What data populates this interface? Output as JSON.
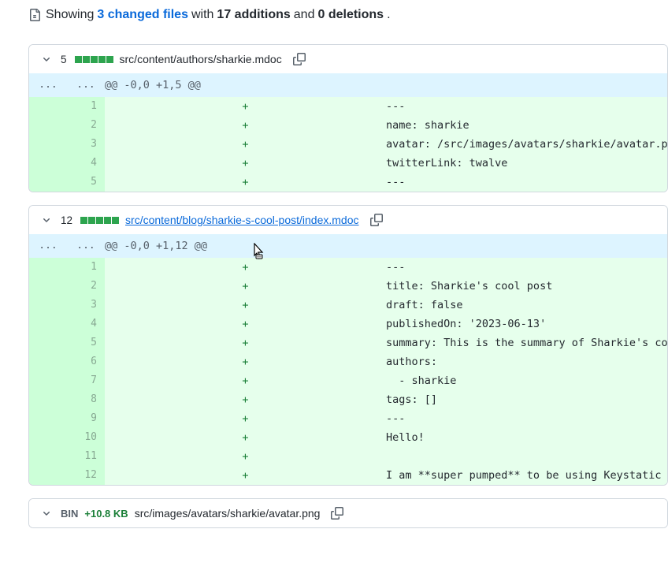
{
  "summary": {
    "prefix": "Showing",
    "files_count": "3 changed files",
    "middle": "with",
    "additions": "17 additions",
    "and": "and",
    "deletions": "0 deletions",
    "suffix": "."
  },
  "files": [
    {
      "count": "5",
      "path": "src/content/authors/sharkie.mdoc",
      "linked": false,
      "hunk_header": "@@ -0,0 +1,5 @@",
      "lines": [
        {
          "num": "1",
          "marker": "+",
          "content": "---"
        },
        {
          "num": "2",
          "marker": "+",
          "content": "name: sharkie"
        },
        {
          "num": "3",
          "marker": "+",
          "content": "avatar: /src/images/avatars/sharkie/avatar.png"
        },
        {
          "num": "4",
          "marker": "+",
          "content": "twitterLink: twalve"
        },
        {
          "num": "5",
          "marker": "+",
          "content": "---"
        }
      ]
    },
    {
      "count": "12",
      "path": "src/content/blog/sharkie-s-cool-post/index.mdoc",
      "linked": true,
      "hunk_header": "@@ -0,0 +1,12 @@",
      "lines": [
        {
          "num": "1",
          "marker": "+",
          "content": "---"
        },
        {
          "num": "2",
          "marker": "+",
          "content": "title: Sharkie's cool post"
        },
        {
          "num": "3",
          "marker": "+",
          "content": "draft: false"
        },
        {
          "num": "4",
          "marker": "+",
          "content": "publishedOn: '2023-06-13'"
        },
        {
          "num": "5",
          "marker": "+",
          "content": "summary: This is the summary of Sharkie's cool post"
        },
        {
          "num": "6",
          "marker": "+",
          "content": "authors:"
        },
        {
          "num": "7",
          "marker": "+",
          "content": "  - sharkie"
        },
        {
          "num": "8",
          "marker": "+",
          "content": "tags: []"
        },
        {
          "num": "9",
          "marker": "+",
          "content": "---"
        },
        {
          "num": "10",
          "marker": "+",
          "content": "Hello!"
        },
        {
          "num": "11",
          "marker": "+",
          "content": ""
        },
        {
          "num": "12",
          "marker": "+",
          "content": "I am **super pumped** to be using Keystatic for my cool post!"
        }
      ]
    }
  ],
  "binary_file": {
    "bin_label": "BIN",
    "size": "+10.8 KB",
    "path": "src/images/avatars/sharkie/avatar.png"
  },
  "ellipsis": "..."
}
